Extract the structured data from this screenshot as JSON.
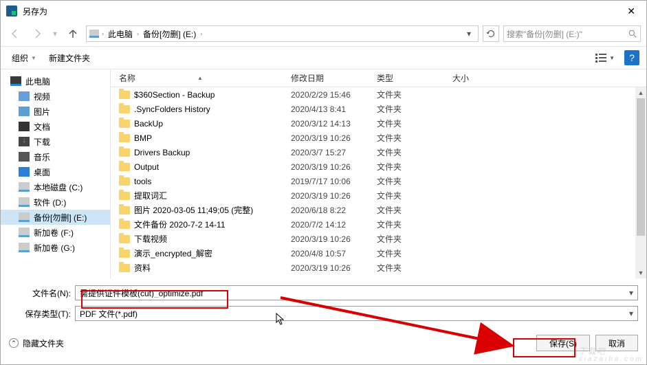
{
  "window": {
    "title": "另存为"
  },
  "nav": {
    "crumbs": [
      "此电脑",
      "备份[勿删] (E:)"
    ],
    "search_placeholder": "搜索\"备份[勿删] (E:)\""
  },
  "toolbar": {
    "organize": "组织",
    "new_folder": "新建文件夹"
  },
  "sidebar": {
    "items": [
      {
        "label": "此电脑",
        "icon": "ic-pc",
        "indent": false
      },
      {
        "label": "视频",
        "icon": "ic-video",
        "indent": true
      },
      {
        "label": "图片",
        "icon": "ic-pic",
        "indent": true
      },
      {
        "label": "文档",
        "icon": "ic-doc",
        "indent": true
      },
      {
        "label": "下载",
        "icon": "ic-down",
        "indent": true
      },
      {
        "label": "音乐",
        "icon": "ic-music",
        "indent": true
      },
      {
        "label": "桌面",
        "icon": "ic-desk",
        "indent": true
      },
      {
        "label": "本地磁盘 (C:)",
        "icon": "ic-drive",
        "indent": true
      },
      {
        "label": "软件 (D:)",
        "icon": "ic-drive",
        "indent": true
      },
      {
        "label": "备份[勿删] (E:)",
        "icon": "ic-drive",
        "indent": true,
        "selected": true
      },
      {
        "label": "新加卷 (F:)",
        "icon": "ic-drive",
        "indent": true
      },
      {
        "label": "新加卷 (G:)",
        "icon": "ic-drive",
        "indent": true
      }
    ]
  },
  "columns": {
    "name": "名称",
    "date": "修改日期",
    "type": "类型",
    "size": "大小"
  },
  "files": [
    {
      "name": "$360Section - Backup",
      "date": "2020/2/29 15:46",
      "type": "文件夹"
    },
    {
      "name": ".SyncFolders History",
      "date": "2020/4/13 8:41",
      "type": "文件夹"
    },
    {
      "name": "BackUp",
      "date": "2020/3/12 14:13",
      "type": "文件夹"
    },
    {
      "name": "BMP",
      "date": "2020/3/19 10:26",
      "type": "文件夹"
    },
    {
      "name": "Drivers Backup",
      "date": "2020/3/7 15:27",
      "type": "文件夹"
    },
    {
      "name": "Output",
      "date": "2020/3/19 10:26",
      "type": "文件夹"
    },
    {
      "name": "tools",
      "date": "2019/7/17 10:06",
      "type": "文件夹"
    },
    {
      "name": "提取词汇",
      "date": "2020/3/19 10:26",
      "type": "文件夹"
    },
    {
      "name": "图片 2020-03-05 11;49;05 (完整)",
      "date": "2020/6/18 8:22",
      "type": "文件夹"
    },
    {
      "name": "文件备份 2020-7-2 14-11",
      "date": "2020/7/2 14:12",
      "type": "文件夹"
    },
    {
      "name": "下载视频",
      "date": "2020/3/19 10:26",
      "type": "文件夹"
    },
    {
      "name": "演示_encrypted_解密",
      "date": "2020/4/8 10:57",
      "type": "文件夹"
    },
    {
      "name": "资料",
      "date": "2020/3/19 10:26",
      "type": "文件夹"
    }
  ],
  "form": {
    "filename_label": "文件名(N):",
    "filename_value": "需提供证件模板(cut)_optimize.pdf",
    "filetype_label": "保存类型(T):",
    "filetype_value": "PDF 文件(*.pdf)"
  },
  "footer": {
    "hide_folders": "隐藏文件夹",
    "save": "保存(S)",
    "cancel": "取消"
  },
  "watermark": {
    "main": "下载吧",
    "sub": "xiazaiba.com"
  }
}
